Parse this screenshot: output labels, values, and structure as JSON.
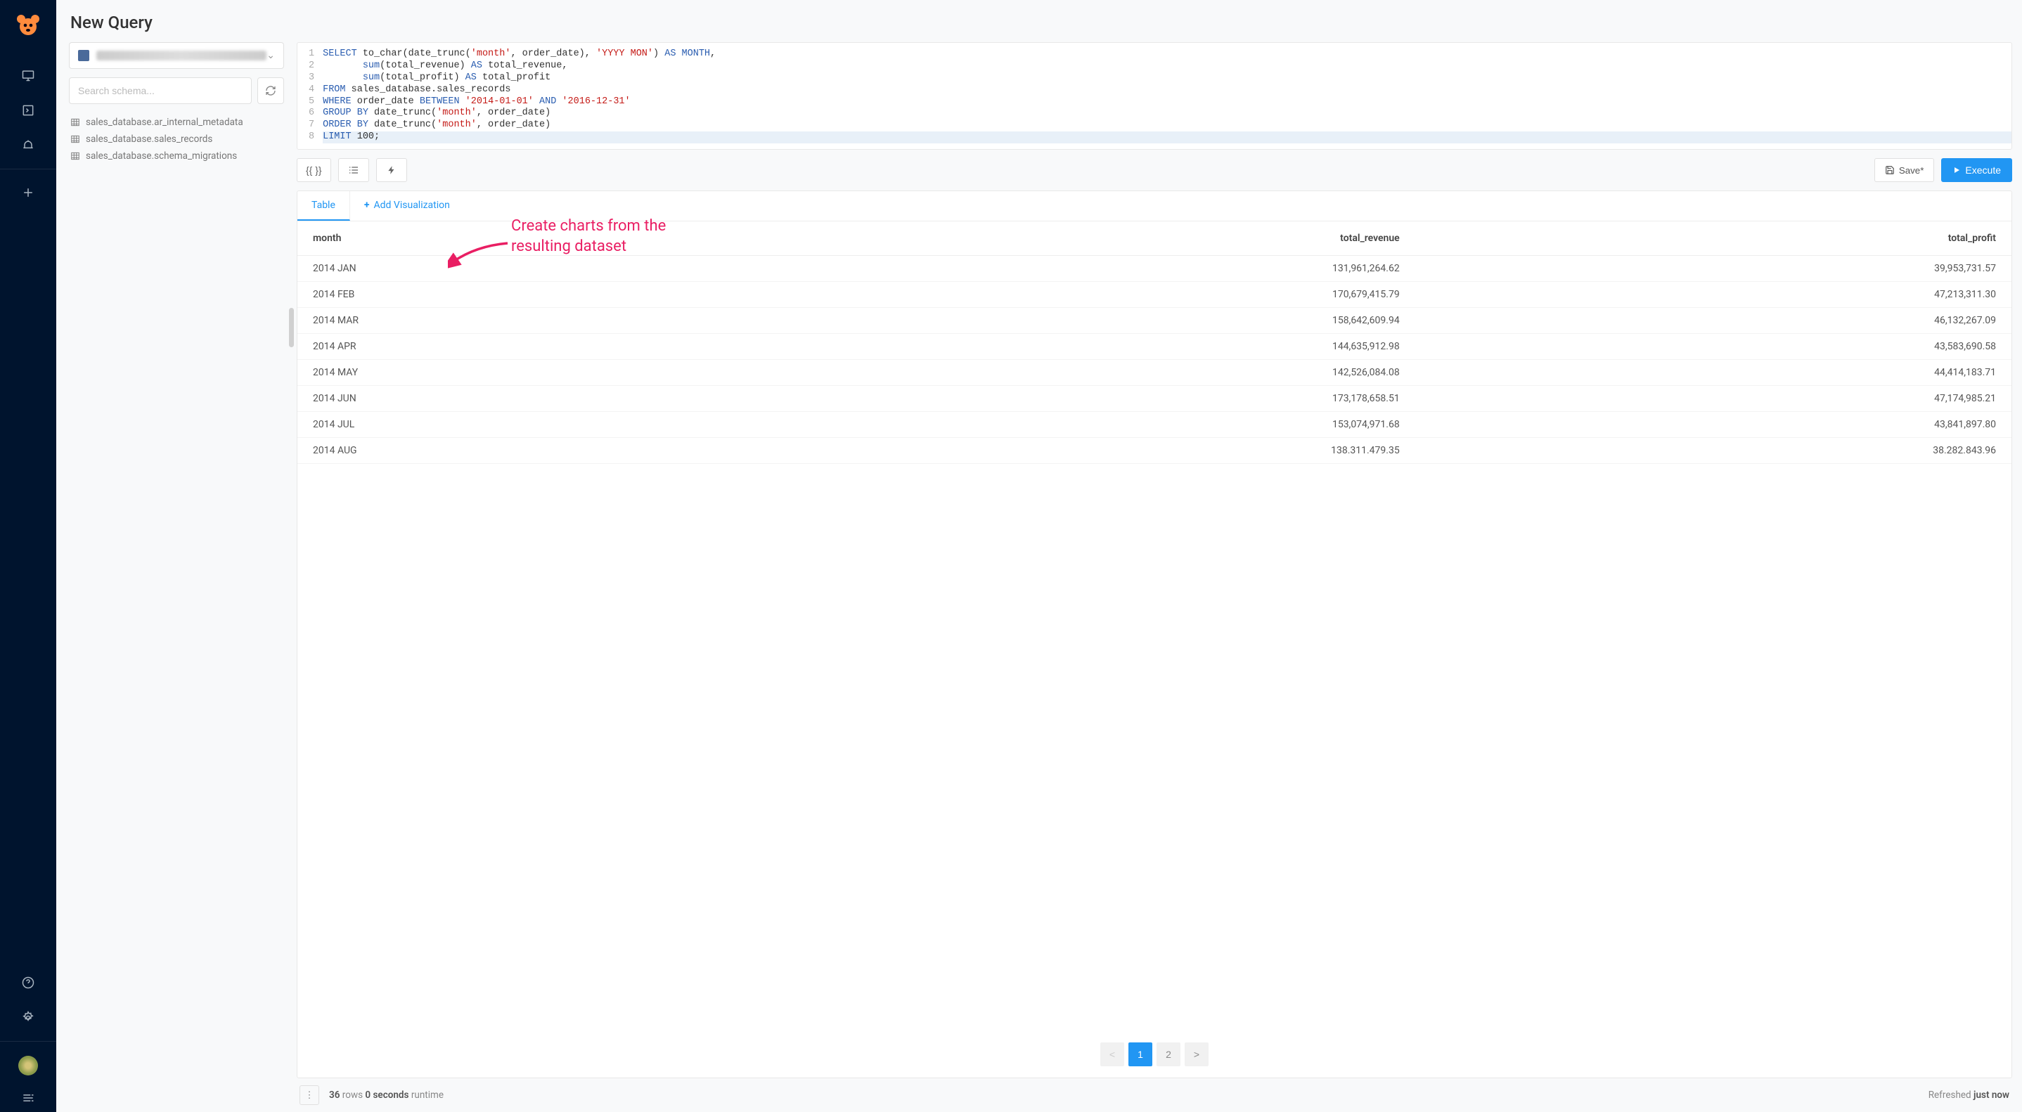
{
  "header": {
    "title": "New Query"
  },
  "datasource": {
    "placeholder_blurred": true
  },
  "schema": {
    "search_placeholder": "Search schema...",
    "tables": [
      "sales_database.ar_internal_metadata",
      "sales_database.sales_records",
      "sales_database.schema_migrations"
    ]
  },
  "editor": {
    "lines": [
      {
        "n": 1,
        "tokens": [
          [
            "kw",
            "SELECT"
          ],
          [
            "t",
            " to_char(date_trunc("
          ],
          [
            "str",
            "'month'"
          ],
          [
            "t",
            ", order_date), "
          ],
          [
            "str",
            "'YYYY MON'"
          ],
          [
            "t",
            ") "
          ],
          [
            "kw",
            "AS"
          ],
          [
            "t",
            " "
          ],
          [
            "kw",
            "MONTH"
          ],
          [
            "t",
            ","
          ]
        ]
      },
      {
        "n": 2,
        "tokens": [
          [
            "t",
            "       "
          ],
          [
            "kw",
            "sum"
          ],
          [
            "t",
            "(total_revenue) "
          ],
          [
            "kw",
            "AS"
          ],
          [
            "t",
            " total_revenue,"
          ]
        ]
      },
      {
        "n": 3,
        "tokens": [
          [
            "t",
            "       "
          ],
          [
            "kw",
            "sum"
          ],
          [
            "t",
            "(total_profit) "
          ],
          [
            "kw",
            "AS"
          ],
          [
            "t",
            " total_profit"
          ]
        ]
      },
      {
        "n": 4,
        "tokens": [
          [
            "kw",
            "FROM"
          ],
          [
            "t",
            " sales_database.sales_records"
          ]
        ]
      },
      {
        "n": 5,
        "tokens": [
          [
            "kw",
            "WHERE"
          ],
          [
            "t",
            " order_date "
          ],
          [
            "kw",
            "BETWEEN"
          ],
          [
            "t",
            " "
          ],
          [
            "str",
            "'2014-01-01'"
          ],
          [
            "t",
            " "
          ],
          [
            "kw",
            "AND"
          ],
          [
            "t",
            " "
          ],
          [
            "str",
            "'2016-12-31'"
          ]
        ]
      },
      {
        "n": 6,
        "tokens": [
          [
            "kw",
            "GROUP BY"
          ],
          [
            "t",
            " date_trunc("
          ],
          [
            "str",
            "'month'"
          ],
          [
            "t",
            ", order_date)"
          ]
        ]
      },
      {
        "n": 7,
        "tokens": [
          [
            "kw",
            "ORDER BY"
          ],
          [
            "t",
            " date_trunc("
          ],
          [
            "str",
            "'month'"
          ],
          [
            "t",
            ", order_date)"
          ]
        ]
      },
      {
        "n": 8,
        "tokens": [
          [
            "kw",
            "LIMIT"
          ],
          [
            "t",
            " "
          ],
          [
            "num",
            "100"
          ],
          [
            "t",
            ";"
          ]
        ],
        "highlight": true
      }
    ]
  },
  "toolbar": {
    "vars": "{{ }}",
    "save": "Save*",
    "execute": "Execute"
  },
  "annotation": {
    "line1": "Create charts from the",
    "line2": "resulting dataset"
  },
  "tabs": {
    "table": "Table",
    "add": "Add Visualization"
  },
  "results": {
    "columns": [
      "month",
      "total_revenue",
      "total_profit"
    ],
    "rows": [
      [
        "2014 JAN",
        "131,961,264.62",
        "39,953,731.57"
      ],
      [
        "2014 FEB",
        "170,679,415.79",
        "47,213,311.30"
      ],
      [
        "2014 MAR",
        "158,642,609.94",
        "46,132,267.09"
      ],
      [
        "2014 APR",
        "144,635,912.98",
        "43,583,690.58"
      ],
      [
        "2014 MAY",
        "142,526,084.08",
        "44,414,183.71"
      ],
      [
        "2014 JUN",
        "173,178,658.51",
        "47,174,985.21"
      ],
      [
        "2014 JUL",
        "153,074,971.68",
        "43,841,897.80"
      ],
      [
        "2014 AUG",
        "138.311.479.35",
        "38.282.843.96"
      ]
    ]
  },
  "pager": {
    "prev": "<",
    "pages": [
      "1",
      "2"
    ],
    "active": "1",
    "next": ">"
  },
  "footer": {
    "rows_count": "36",
    "rows_label": "rows",
    "runtime_val": "0 seconds",
    "runtime_label": "runtime",
    "refreshed_label": "Refreshed",
    "refreshed_val": "just now"
  }
}
